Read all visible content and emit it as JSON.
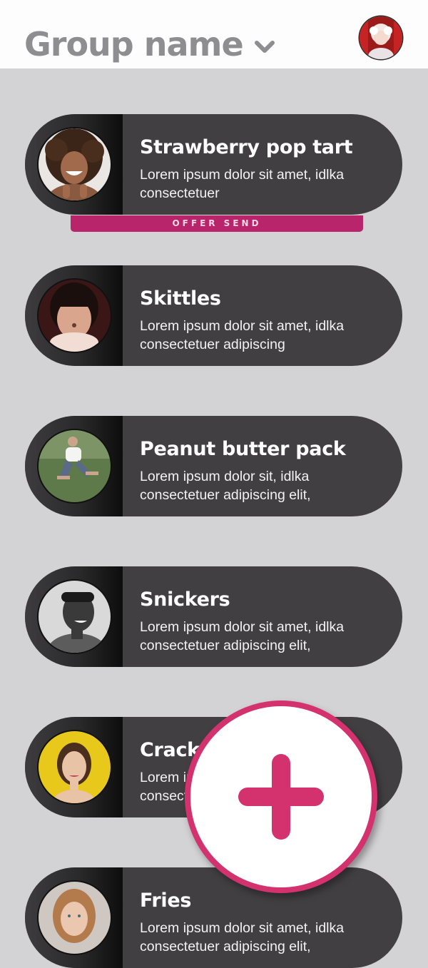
{
  "header": {
    "group_name": "Group name",
    "chevron_icon": "chevron-down-icon"
  },
  "colors": {
    "card_bg": "#413f42",
    "accent": "#d3326f",
    "offer_bg": "#b8256b",
    "page_bg": "#d3d2d4"
  },
  "items": [
    {
      "name": "Strawberry pop tart",
      "desc": "Lorem ipsum dolor sit amet, idlka consectetuer"
    },
    {
      "name": "Skittles",
      "desc": "Lorem ipsum dolor sit amet, idlka consectetuer adipiscing"
    },
    {
      "name": "Peanut butter pack",
      "desc": "Lorem ipsum dolor sit, idlka consectetuer adipiscing elit,"
    },
    {
      "name": "Snickers",
      "desc": "Lorem ipsum dolor sit amet, idlka consectetuer adipiscing elit,"
    },
    {
      "name": "Crackers",
      "desc": "Lorem ipsum dolor sit amet, idlka consectetuer adipiscing elit,"
    },
    {
      "name": "Fries",
      "desc": "Lorem ipsum dolor sit amet, idlka consectetuer adipiscing elit,"
    }
  ],
  "offer_label": "OFFER SEND",
  "fab_icon": "plus-icon"
}
